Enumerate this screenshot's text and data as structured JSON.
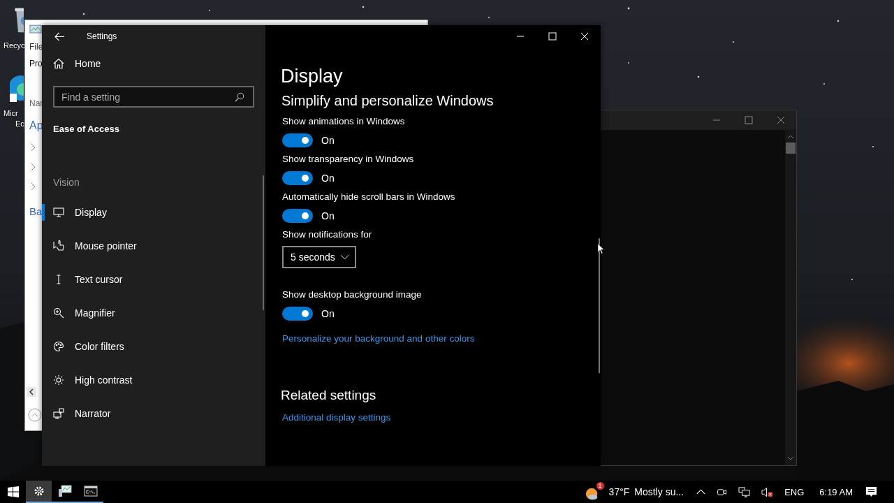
{
  "desktop_icons": [
    {
      "lines": [
        "Recyc"
      ]
    },
    {
      "lines": [
        "Micr",
        "Ec"
      ]
    }
  ],
  "back_window": {
    "labels": [
      {
        "text": "File",
        "kind": "menu"
      },
      {
        "text": "Pro",
        "kind": "tab"
      },
      {
        "text": "Nar",
        "kind": "header"
      },
      {
        "text": "Ap",
        "kind": "group"
      },
      {
        "text": "Ba",
        "kind": "group"
      }
    ]
  },
  "settings": {
    "title": "Settings",
    "home": "Home",
    "search": {
      "placeholder": "Find a setting"
    },
    "section": "Ease of Access",
    "group": "Vision",
    "nav": [
      {
        "label": "Display",
        "selected": true
      },
      {
        "label": "Mouse pointer",
        "selected": false
      },
      {
        "label": "Text cursor",
        "selected": false
      },
      {
        "label": "Magnifier",
        "selected": false
      },
      {
        "label": "Color filters",
        "selected": false
      },
      {
        "label": "High contrast",
        "selected": false
      },
      {
        "label": "Narrator",
        "selected": false
      }
    ],
    "page_title": "Display",
    "heading": "Simplify and personalize Windows",
    "options": [
      {
        "kind": "toggle",
        "label": "Show animations in Windows",
        "on": true,
        "state": "On"
      },
      {
        "kind": "toggle",
        "label": "Show transparency in Windows",
        "on": true,
        "state": "On"
      },
      {
        "kind": "toggle",
        "label": "Automatically hide scroll bars in Windows",
        "on": true,
        "state": "On"
      },
      {
        "kind": "dropdown",
        "label": "Show notifications for",
        "value": "5 seconds"
      },
      {
        "kind": "toggle",
        "label": "Show desktop background image",
        "on": true,
        "state": "On"
      },
      {
        "kind": "link",
        "label": "Personalize your background and other colors"
      }
    ],
    "related": {
      "title": "Related settings",
      "links": [
        "Additional display settings"
      ]
    }
  },
  "taskbar": {
    "apps": [
      {
        "selected": true
      },
      {
        "selected": false
      },
      {
        "selected": false
      }
    ],
    "weather": {
      "badge": "1",
      "temperature": "37°F",
      "condition": "Mostly su..."
    },
    "language": "ENG",
    "time": "6:19 AM"
  }
}
